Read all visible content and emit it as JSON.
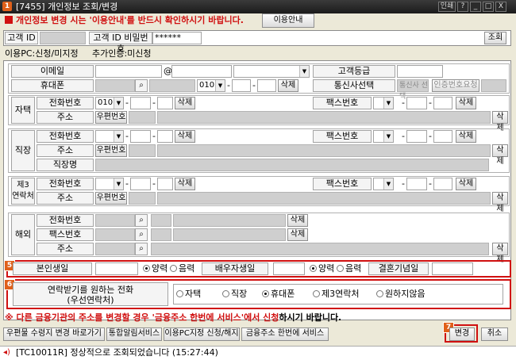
{
  "window": {
    "number_badge": "1",
    "title": "[7455] 개인정보 조회/변경",
    "controls": [
      "인쇄",
      "?",
      "_",
      "□",
      "X"
    ]
  },
  "notice": {
    "text": "개인정보 변경 시는 '이용안내'를 반드시 확인하시기 바랍니다.",
    "guide_button": "이용안내"
  },
  "login": {
    "id_label": "고객 ID",
    "pw_label": "고객 ID 비밀번호",
    "pw_value": "******",
    "search_button": "조회"
  },
  "status": {
    "pc_status": "이용PC:신청/미지정",
    "auth_status": "추가인증:미신청"
  },
  "contact": {
    "email_label": "이메일",
    "at": "@",
    "grade_label": "고객등급",
    "mobile_label": "휴대폰",
    "mobile_prefix": "010",
    "carrier_label": "통신사선택",
    "carrier_value": "통신사 선택",
    "auth_request_button": "인증번호요청",
    "delete_button": "삭제"
  },
  "home": {
    "section_label": "자택",
    "phone_label": "전화번호",
    "phone_prefix": "010",
    "fax_label": "팩스번호",
    "address_label": "주소",
    "zip_button": "우편번호",
    "delete_button": "삭제"
  },
  "work": {
    "section_label": "직장",
    "phone_label": "전화번호",
    "fax_label": "팩스번호",
    "address_label": "주소",
    "zip_button": "우편번호",
    "company_label": "직장명",
    "delete_button": "삭제"
  },
  "third": {
    "section_label": "제3\n연락처",
    "phone_label": "전화번호",
    "fax_label": "팩스번호",
    "address_label": "주소",
    "zip_button": "우편번호",
    "delete_button": "삭제"
  },
  "overseas": {
    "section_label": "해외",
    "phone_label": "전화번호",
    "fax_label": "팩스번호",
    "address_label": "주소",
    "delete_button": "삭제"
  },
  "birthday": {
    "badge": "5",
    "self_label": "본인생일",
    "solar": "양력",
    "lunar": "음력",
    "spouse_label": "배우자생일",
    "anniv_label": "결혼기념일"
  },
  "preferred": {
    "badge": "6",
    "label": "연락받기를 원하는 전화\n(우선연락처)",
    "options": [
      "자택",
      "직장",
      "휴대폰",
      "제3연락처",
      "원하지않음"
    ],
    "selected": "휴대폰"
  },
  "footer_notice": {
    "prefix": "※ ",
    "part1": "다른 금융기관의 주소를 변경할 경우 '금융주소 한번에 서비스'에서 신청",
    "part2": "하시기 바랍니다."
  },
  "actions": {
    "buttons": [
      "우편물 수령지 변경 바로가기",
      "통합알림서비스",
      "이용PC지정 신청/해지",
      "금융주소 한번에 서비스"
    ],
    "change_badge": "7",
    "change_button": "변경",
    "cancel_button": "취소"
  },
  "statusbar": {
    "message": "[TC10011R] 정상적으로 조회되었습니다 (15:27:44)"
  }
}
